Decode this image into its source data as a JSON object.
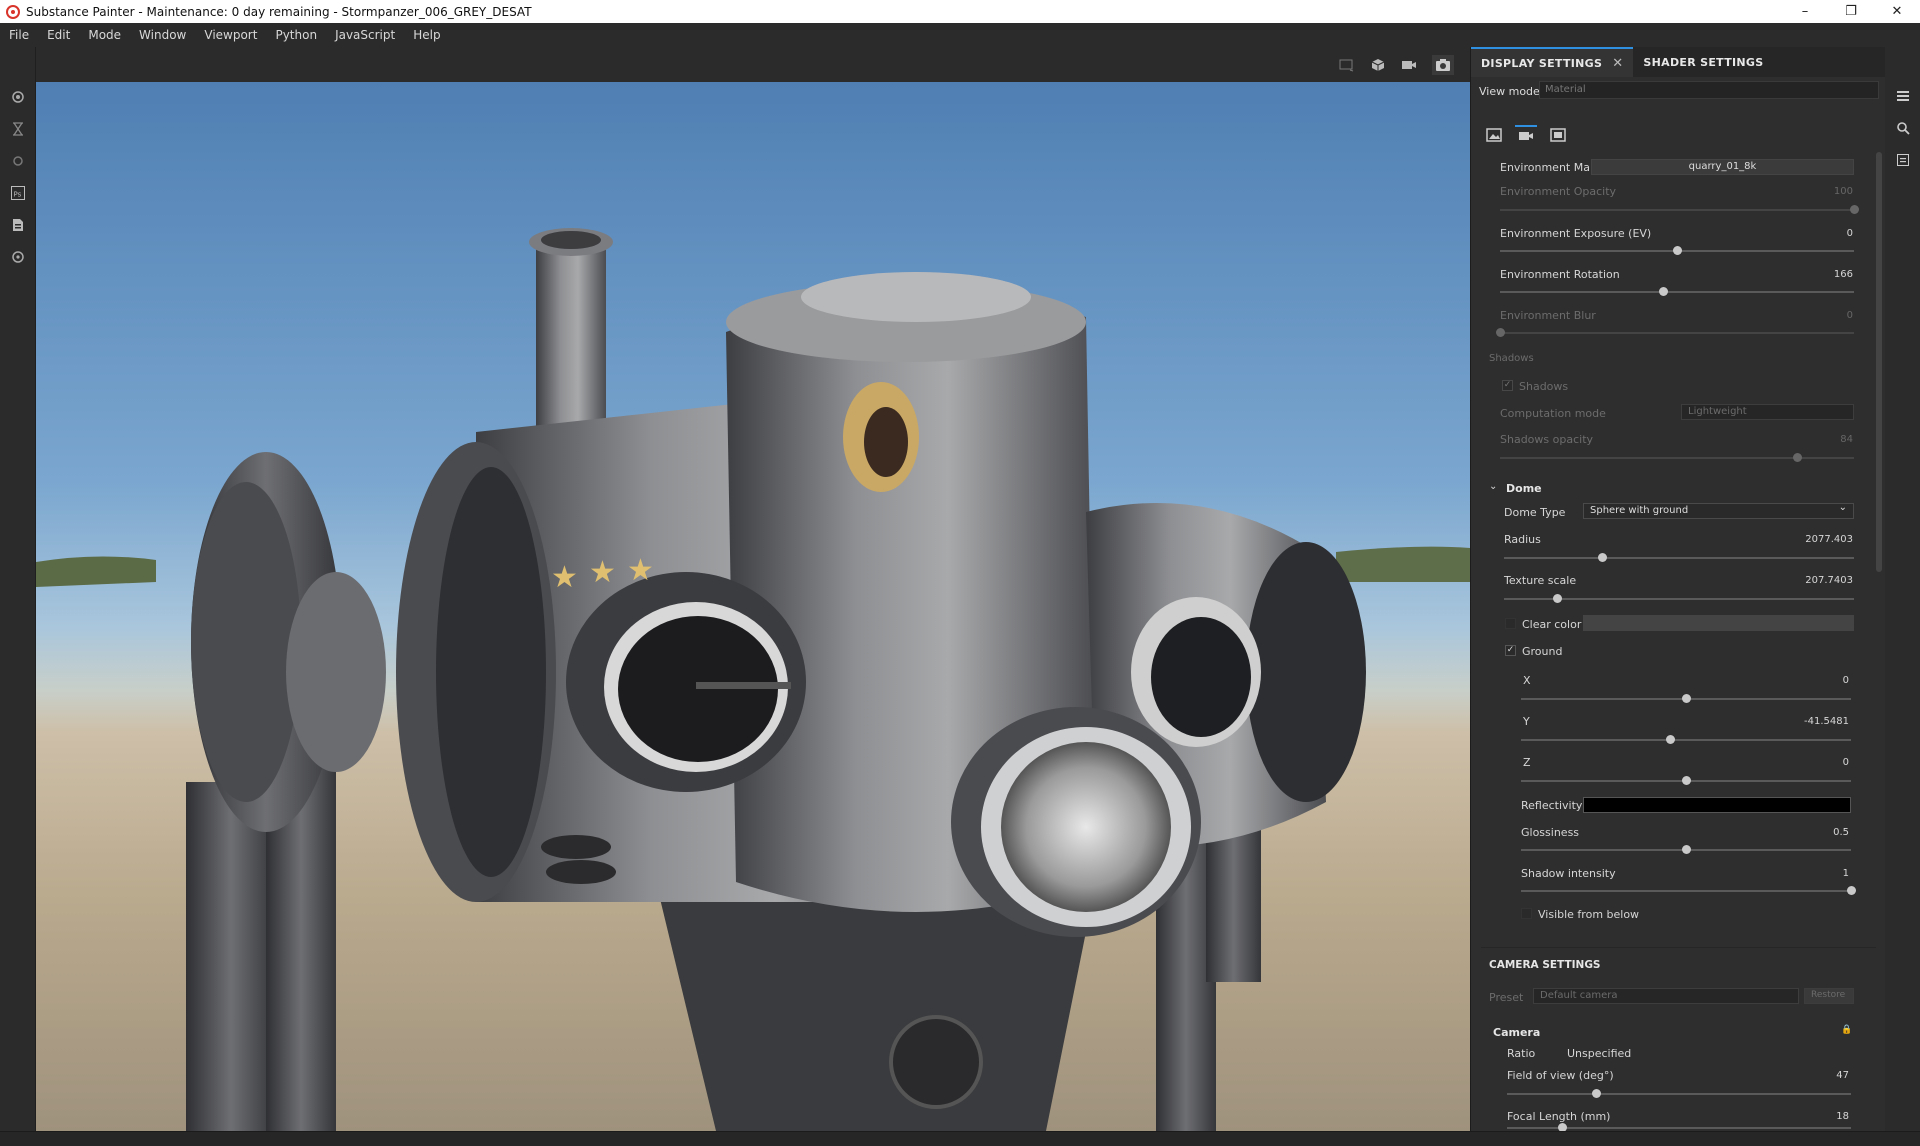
{
  "window": {
    "title": "Substance Painter - Maintenance: 0 day remaining - Stormpanzer_006_GREY_DESAT",
    "minimize": "–",
    "maximize": "❐",
    "close": "✕"
  },
  "menu": [
    "File",
    "Edit",
    "Mode",
    "Window",
    "Viewport",
    "Python",
    "JavaScript",
    "Help"
  ],
  "panel": {
    "tabs": [
      {
        "label": "DISPLAY SETTINGS",
        "close": "✕"
      },
      {
        "label": "SHADER SETTINGS"
      }
    ],
    "view_mode": {
      "label": "View mode",
      "value": "Material"
    },
    "environment": {
      "map": {
        "label": "Environment Map",
        "value": "quarry_01_8k"
      },
      "opacity": {
        "label": "Environment Opacity",
        "value": "100",
        "fraction": 1.0
      },
      "exposure": {
        "label": "Environment Exposure (EV)",
        "value": "0",
        "fraction": 0.5
      },
      "rotation": {
        "label": "Environment Rotation",
        "value": "166",
        "fraction": 0.46
      },
      "blur": {
        "label": "Environment Blur",
        "value": "0",
        "fraction": 0.0
      }
    },
    "shadows": {
      "section": "Shadows",
      "checkbox": "Shadows",
      "checked_mark": "✓",
      "computation": {
        "label": "Computation mode",
        "value": "Lightweight"
      },
      "opacity": {
        "label": "Shadows opacity",
        "value": "84",
        "fraction": 0.84
      }
    },
    "dome": {
      "section": "Dome",
      "type": {
        "label": "Dome Type",
        "value": "Sphere with ground",
        "arrow": "⌄"
      },
      "radius": {
        "label": "Radius",
        "value": "2077.403",
        "fraction": 0.28
      },
      "texture_scale": {
        "label": "Texture scale",
        "value": "207.7403",
        "fraction": 0.15
      },
      "clear_color": {
        "label": "Clear color"
      },
      "ground": {
        "label": "Ground",
        "mark": "✓"
      },
      "x": {
        "label": "X",
        "value": "0",
        "fraction": 0.5
      },
      "y": {
        "label": "Y",
        "value": "-41.5481",
        "fraction": 0.45
      },
      "z": {
        "label": "Z",
        "value": "0",
        "fraction": 0.5
      },
      "reflectivity": {
        "label": "Reflectivity"
      },
      "glossiness": {
        "label": "Glossiness",
        "value": "0.5",
        "fraction": 0.5
      },
      "shadow_intensity": {
        "label": "Shadow intensity",
        "value": "1",
        "fraction": 1.0
      },
      "visible_below": {
        "label": "Visible from below"
      }
    },
    "camera_settings": {
      "section": "CAMERA SETTINGS",
      "preset": {
        "label": "Preset",
        "value": "Default camera",
        "button": "Restore"
      },
      "camera": {
        "label": "Camera",
        "lock": "🔒"
      },
      "ratio": {
        "label": "Ratio",
        "value": "Unspecified"
      },
      "fov": {
        "label": "Field of view (deg°)",
        "value": "47",
        "fraction": 0.26
      },
      "focal": {
        "label": "Focal Length (mm)",
        "value": "18",
        "fraction": 0.16
      }
    }
  },
  "colors": {
    "accent": "#2f8fe0",
    "panel_bg": "#2e2e2e",
    "app_bg": "#2b2b2b"
  }
}
